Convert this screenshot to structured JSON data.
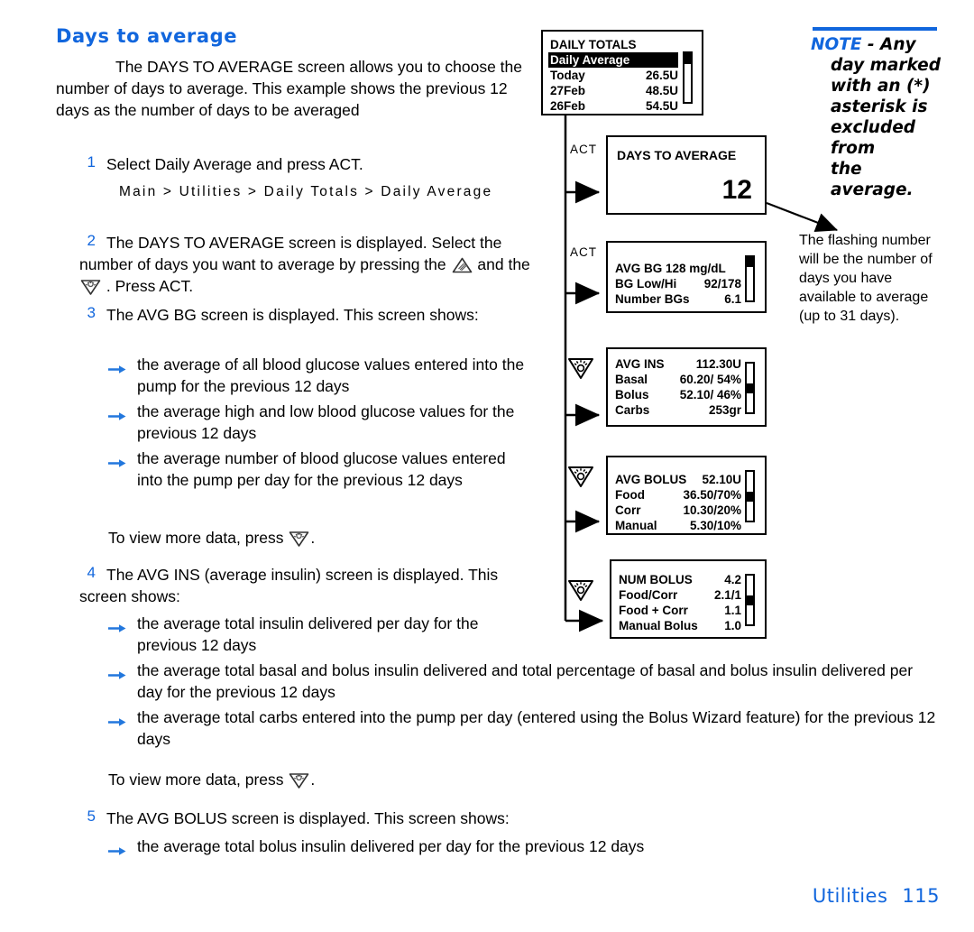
{
  "page": {
    "title": "Days to average",
    "intro": "The DAYS TO AVERAGE screen allows you to choose the number of days to average. This example shows the previous 12 days as the number of days to be averaged",
    "footer_section": "Utilities",
    "footer_page": "115"
  },
  "steps": {
    "s1": {
      "num": "1",
      "text": "Select Daily Average and press ACT."
    },
    "navpath": "Main > Utilities > Daily Totals > Daily Average",
    "s2": {
      "num": "2",
      "part_a": "The DAYS TO AVERAGE screen is displayed. Select the number of days you want to average by pressing the",
      "part_b": "and the",
      "part_c": ". Press ACT."
    },
    "s3": {
      "num": "3",
      "text": "The AVG BG screen is displayed. This screen shows:"
    },
    "s3_bullets": [
      "the average of all blood glucose values entered into the pump for the previous 12 days",
      "the average high and low blood glucose values for the previous 12 days",
      "the average number of blood glucose values entered into the pump per day for the previous 12 days"
    ],
    "more_data_1": {
      "pre": "To view more data, press",
      "post": "."
    },
    "s4": {
      "num": "4",
      "text": "The AVG INS (average insulin) screen is displayed. This screen shows:"
    },
    "s4_bullets": [
      "the average total insulin delivered per day for the previous 12 days",
      "the average total basal and bolus insulin delivered and total percentage of basal and bolus insulin delivered per day for the previous 12 days",
      "the average total carbs entered into the pump per day (entered using the Bolus Wizard feature) for the previous 12 days"
    ],
    "more_data_2": {
      "pre": "To view more data, press",
      "post": "."
    },
    "s5": {
      "num": "5",
      "text": "The AVG BOLUS screen is displayed. This screen shows:"
    },
    "s5_bullets": [
      "the average total bolus insulin delivered per day for the previous 12 days"
    ]
  },
  "note": {
    "label": "NOTE",
    "lines": [
      "- Any",
      "day marked",
      "with an (*)",
      "asterisk is",
      "excluded from",
      "the average."
    ],
    "rule_color": "#1166dd"
  },
  "callout": {
    "text": "The flashing number will be the number of days you have available to average (up to 31 days)."
  },
  "flow": {
    "transitions": {
      "act": "ACT",
      "down_key": "down-arrow-key"
    },
    "screens": [
      {
        "id": "daily-totals",
        "title": "DAILY TOTALS",
        "rows": [
          {
            "label": "DAILY TOTALS",
            "value": "",
            "single": true,
            "highlight": false
          },
          {
            "label": "Daily Average",
            "value": "",
            "single": true,
            "highlight": true
          },
          {
            "label": "Today",
            "value": "26.5U",
            "highlight": false
          },
          {
            "label": "27Feb",
            "value": "48.5U",
            "highlight": false
          },
          {
            "label": "26Feb",
            "value": "54.5U",
            "highlight": false
          }
        ],
        "scroll_thumb": "top"
      },
      {
        "id": "days-to-average",
        "title": "DAYS TO AVERAGE",
        "value": "12",
        "transition": "ACT"
      },
      {
        "id": "avg-bg",
        "transition": "ACT",
        "rows": [
          {
            "label": "AVG BG 128 mg/dL",
            "value": "",
            "single": true
          },
          {
            "label": "BG Low/Hi",
            "value": "92/178"
          },
          {
            "label": "Number BGs",
            "value": "6.1"
          }
        ],
        "scroll_thumb": "top"
      },
      {
        "id": "avg-ins",
        "transition": "down-arrow-key",
        "rows": [
          {
            "label": "AVG INS",
            "value": "112.30U"
          },
          {
            "label": "Basal",
            "value": "60.20/ 54%"
          },
          {
            "label": "Bolus",
            "value": "52.10/ 46%"
          },
          {
            "label": "Carbs",
            "value": "253gr"
          }
        ],
        "scroll_thumb": "middle"
      },
      {
        "id": "avg-bolus",
        "transition": "down-arrow-key",
        "rows": [
          {
            "label": "AVG BOLUS",
            "value": "52.10U"
          },
          {
            "label": "Food",
            "value": "36.50/70%"
          },
          {
            "label": "Corr",
            "value": "10.30/20%"
          },
          {
            "label": "Manual",
            "value": "5.30/10%"
          }
        ],
        "scroll_thumb": "middle"
      },
      {
        "id": "num-bolus",
        "transition": "down-arrow-key",
        "rows": [
          {
            "label": "NUM BOLUS",
            "value": "4.2"
          },
          {
            "label": "Food/Corr",
            "value": "2.1/1"
          },
          {
            "label": "Food + Corr",
            "value": "1.1"
          },
          {
            "label": "Manual Bolus",
            "value": "1.0"
          }
        ],
        "scroll_thumb": "middle"
      }
    ]
  }
}
